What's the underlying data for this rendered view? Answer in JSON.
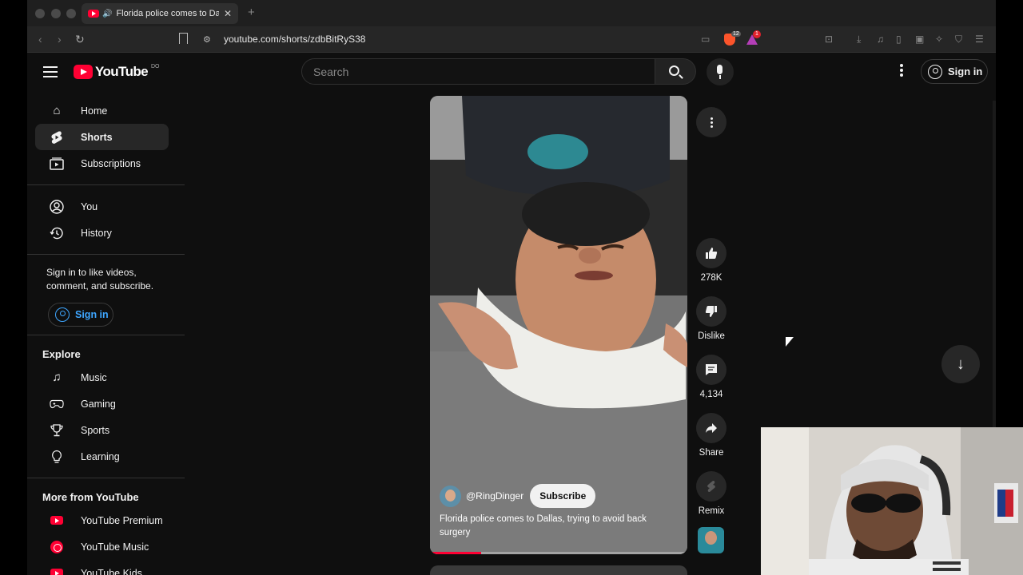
{
  "browser": {
    "tab_title": "Florida police comes to Dall",
    "tab_audio_icon": "speaker-icon",
    "url": "youtube.com/shorts/zdbBitRyS38",
    "brave_badge": "12",
    "rewards_badge": "1"
  },
  "header": {
    "logo_text": "YouTube",
    "region": "DO",
    "search_placeholder": "Search",
    "sign_in": "Sign in"
  },
  "sidebar": {
    "main": [
      {
        "label": "Home",
        "icon": "home-icon"
      },
      {
        "label": "Shorts",
        "icon": "shorts-icon",
        "active": true
      },
      {
        "label": "Subscriptions",
        "icon": "subscriptions-icon"
      }
    ],
    "you": [
      {
        "label": "You",
        "icon": "user-icon"
      },
      {
        "label": "History",
        "icon": "history-icon"
      }
    ],
    "signin_prompt": "Sign in to like videos, comment, and subscribe.",
    "signin_button": "Sign in",
    "explore_title": "Explore",
    "explore": [
      {
        "label": "Music",
        "icon": "music-icon"
      },
      {
        "label": "Gaming",
        "icon": "gaming-icon"
      },
      {
        "label": "Sports",
        "icon": "trophy-icon"
      },
      {
        "label": "Learning",
        "icon": "lightbulb-icon"
      }
    ],
    "more_title": "More from YouTube",
    "more": [
      {
        "label": "YouTube Premium",
        "icon": "youtube-premium-icon"
      },
      {
        "label": "YouTube Music",
        "icon": "youtube-music-icon"
      },
      {
        "label": "YouTube Kids",
        "icon": "youtube-kids-icon"
      }
    ]
  },
  "short": {
    "channel": "@RingDinger",
    "subscribe": "Subscribe",
    "title": "Florida police comes to Dallas, trying to avoid back surgery",
    "progress": 0.2
  },
  "actions": {
    "likes": "278K",
    "dislike": "Dislike",
    "comments": "4,134",
    "share": "Share",
    "remix": "Remix"
  },
  "colors": {
    "brand_red": "#ff0033",
    "link_blue": "#3ea6ff",
    "background": "#0f0f0f"
  }
}
